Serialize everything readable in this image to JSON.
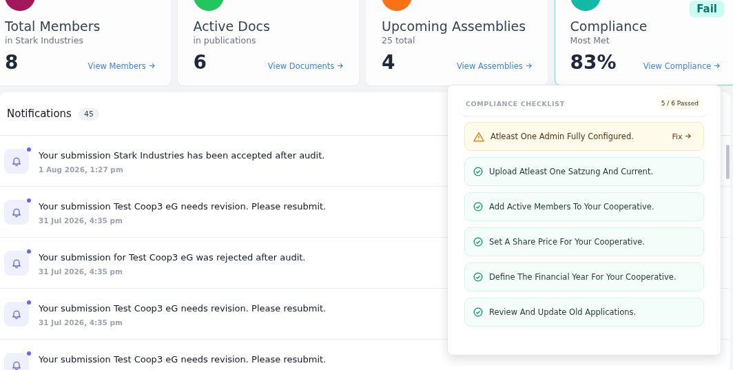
{
  "stat_cards": [
    {
      "title": "Total Members",
      "subtitle": "in Stark Industries",
      "value": "8",
      "link": "View Members",
      "color": "#a3185a",
      "highlighted": false
    },
    {
      "title": "Active Docs",
      "subtitle": "in publications",
      "value": "6",
      "link": "View Documents",
      "color": "#22c55e",
      "highlighted": false
    },
    {
      "title": "Upcoming Assemblies",
      "subtitle": "25 total",
      "value": "4",
      "link": "View Assemblies",
      "color": "#f97316",
      "highlighted": false
    },
    {
      "title": "Compliance",
      "subtitle": "Most Met",
      "value": "83%",
      "link": "View Compliance",
      "color": "#14b8a6",
      "highlighted": true,
      "badge": "Fail"
    }
  ],
  "notifications": {
    "title": "Notifications",
    "count": "45",
    "items": [
      {
        "message": "Your submission Stark Industries has been accepted after audit.",
        "time": "1 Aug 2026, 1:27 pm",
        "unread": true
      },
      {
        "message": "Your submission Test Coop3 eG needs revision. Please resubmit.",
        "time": "31 Jul 2026, 4:35 pm",
        "unread": true
      },
      {
        "message": "Your submission for Test Coop3 eG was rejected after audit.",
        "time": "31 Jul 2026, 4:35 pm",
        "unread": true
      },
      {
        "message": "Your submission Test Coop3 eG needs revision. Please resubmit.",
        "time": "31 Jul 2026, 4:35 pm",
        "unread": true
      },
      {
        "message": "Your submission Test Coop3 eG needs revision. Please resubmit.",
        "unread": true
      }
    ]
  },
  "compliance_checklist": {
    "title": "COMPLIANCE CHECKLIST",
    "summary": "5 / 6 Passed",
    "items": [
      {
        "kind": "warning",
        "label": "Atleast One Admin Fully Configured.",
        "action": "Fix"
      },
      {
        "kind": "passed",
        "label": "Upload Atleast One Satzung And Current."
      },
      {
        "kind": "passed",
        "label": "Add Active Members To Your Cooperative."
      },
      {
        "kind": "passed",
        "label": "Set A Share Price For Your Cooperative."
      },
      {
        "kind": "passed",
        "label": "Define The Financial Year For Your Cooperative."
      },
      {
        "kind": "passed",
        "label": "Review And Update Old Applications."
      }
    ]
  }
}
